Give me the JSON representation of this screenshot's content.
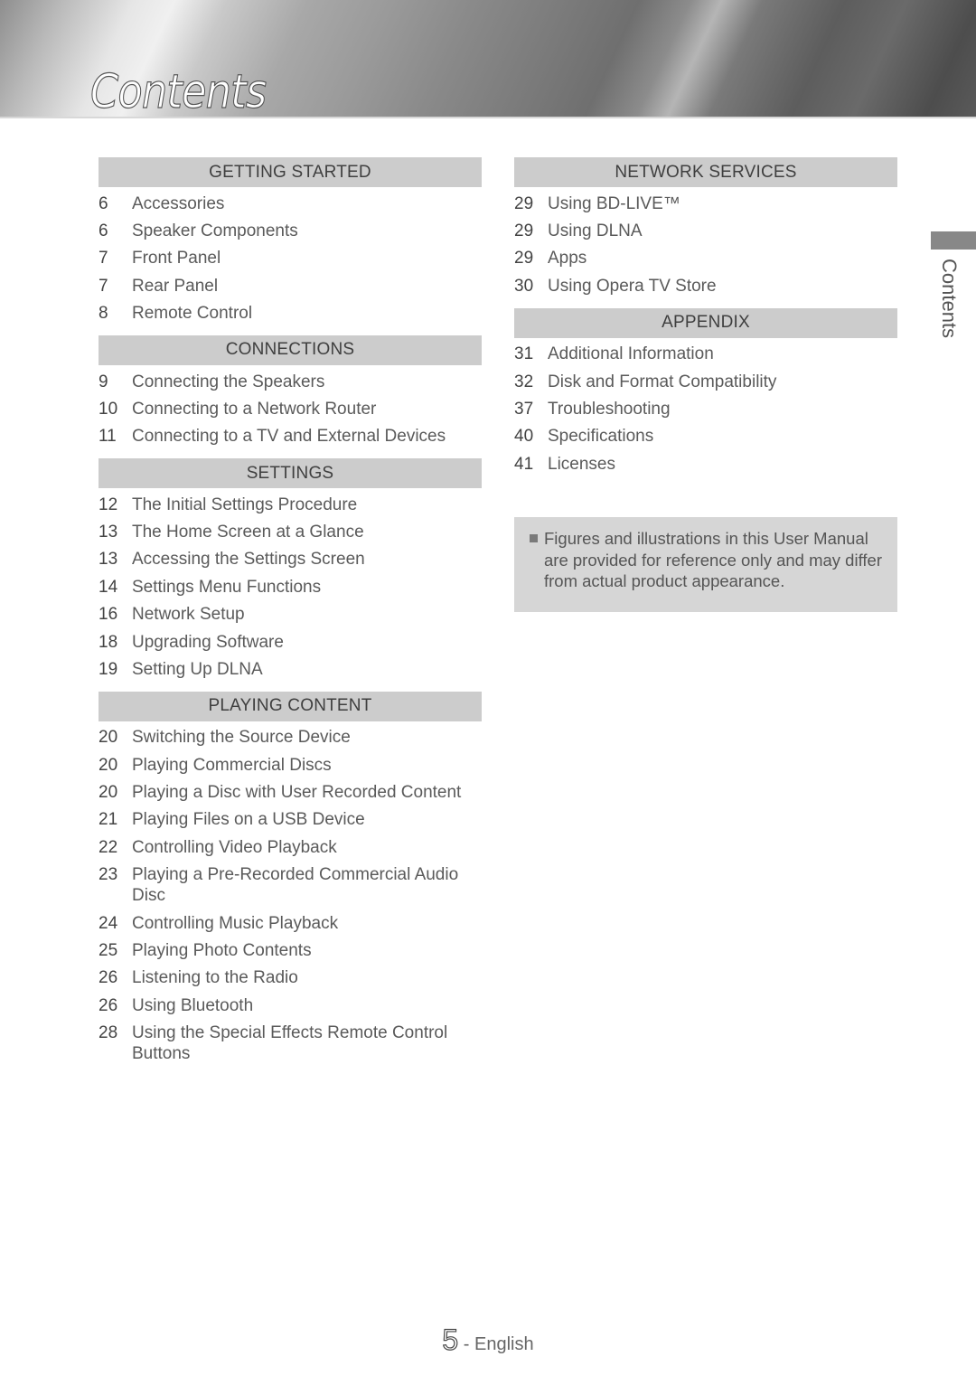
{
  "header": {
    "title": "Contents"
  },
  "side_tab": {
    "label": "Contents"
  },
  "left_column": [
    {
      "heading": "GETTING STARTED",
      "items": [
        {
          "page": "6",
          "title": "Accessories"
        },
        {
          "page": "6",
          "title": "Speaker Components"
        },
        {
          "page": "7",
          "title": "Front Panel"
        },
        {
          "page": "7",
          "title": "Rear Panel"
        },
        {
          "page": "8",
          "title": "Remote Control"
        }
      ]
    },
    {
      "heading": "CONNECTIONS",
      "items": [
        {
          "page": "9",
          "title": "Connecting the Speakers"
        },
        {
          "page": "10",
          "title": "Connecting to a Network Router"
        },
        {
          "page": "11",
          "title": "Connecting to a TV and External Devices"
        }
      ]
    },
    {
      "heading": "SETTINGS",
      "items": [
        {
          "page": "12",
          "title": "The Initial Settings Procedure"
        },
        {
          "page": "13",
          "title": "The Home Screen at a Glance"
        },
        {
          "page": "13",
          "title": "Accessing the Settings Screen"
        },
        {
          "page": "14",
          "title": "Settings Menu Functions"
        },
        {
          "page": "16",
          "title": "Network Setup"
        },
        {
          "page": "18",
          "title": "Upgrading Software"
        },
        {
          "page": "19",
          "title": "Setting Up DLNA"
        }
      ]
    },
    {
      "heading": "PLAYING CONTENT",
      "items": [
        {
          "page": "20",
          "title": "Switching the Source Device"
        },
        {
          "page": "20",
          "title": "Playing Commercial Discs"
        },
        {
          "page": "20",
          "title": "Playing a Disc with User Recorded Content"
        },
        {
          "page": "21",
          "title": "Playing Files on a USB Device"
        },
        {
          "page": "22",
          "title": "Controlling Video Playback"
        },
        {
          "page": "23",
          "title": "Playing a Pre-Recorded Commercial Audio Disc"
        },
        {
          "page": "24",
          "title": "Controlling Music Playback"
        },
        {
          "page": "25",
          "title": "Playing Photo Contents"
        },
        {
          "page": "26",
          "title": "Listening to the Radio"
        },
        {
          "page": "26",
          "title": "Using Bluetooth"
        },
        {
          "page": "28",
          "title": "Using the Special Effects Remote Control Buttons"
        }
      ]
    }
  ],
  "right_column": [
    {
      "heading": "NETWORK SERVICES",
      "items": [
        {
          "page": "29",
          "title": "Using BD-LIVE™"
        },
        {
          "page": "29",
          "title": "Using DLNA"
        },
        {
          "page": "29",
          "title": "Apps"
        },
        {
          "page": "30",
          "title": "Using Opera TV Store"
        }
      ]
    },
    {
      "heading": "APPENDIX",
      "items": [
        {
          "page": "31",
          "title": "Additional Information"
        },
        {
          "page": "32",
          "title": "Disk and Format Compatibility"
        },
        {
          "page": "37",
          "title": "Troubleshooting"
        },
        {
          "page": "40",
          "title": "Specifications"
        },
        {
          "page": "41",
          "title": "Licenses"
        }
      ]
    }
  ],
  "note": {
    "icon": "square-bullet-icon",
    "text": "Figures and illustrations in this User Manual are provided for reference only and may differ from actual product appearance."
  },
  "footer": {
    "page_number": "5",
    "separator": " - ",
    "language": "English"
  }
}
